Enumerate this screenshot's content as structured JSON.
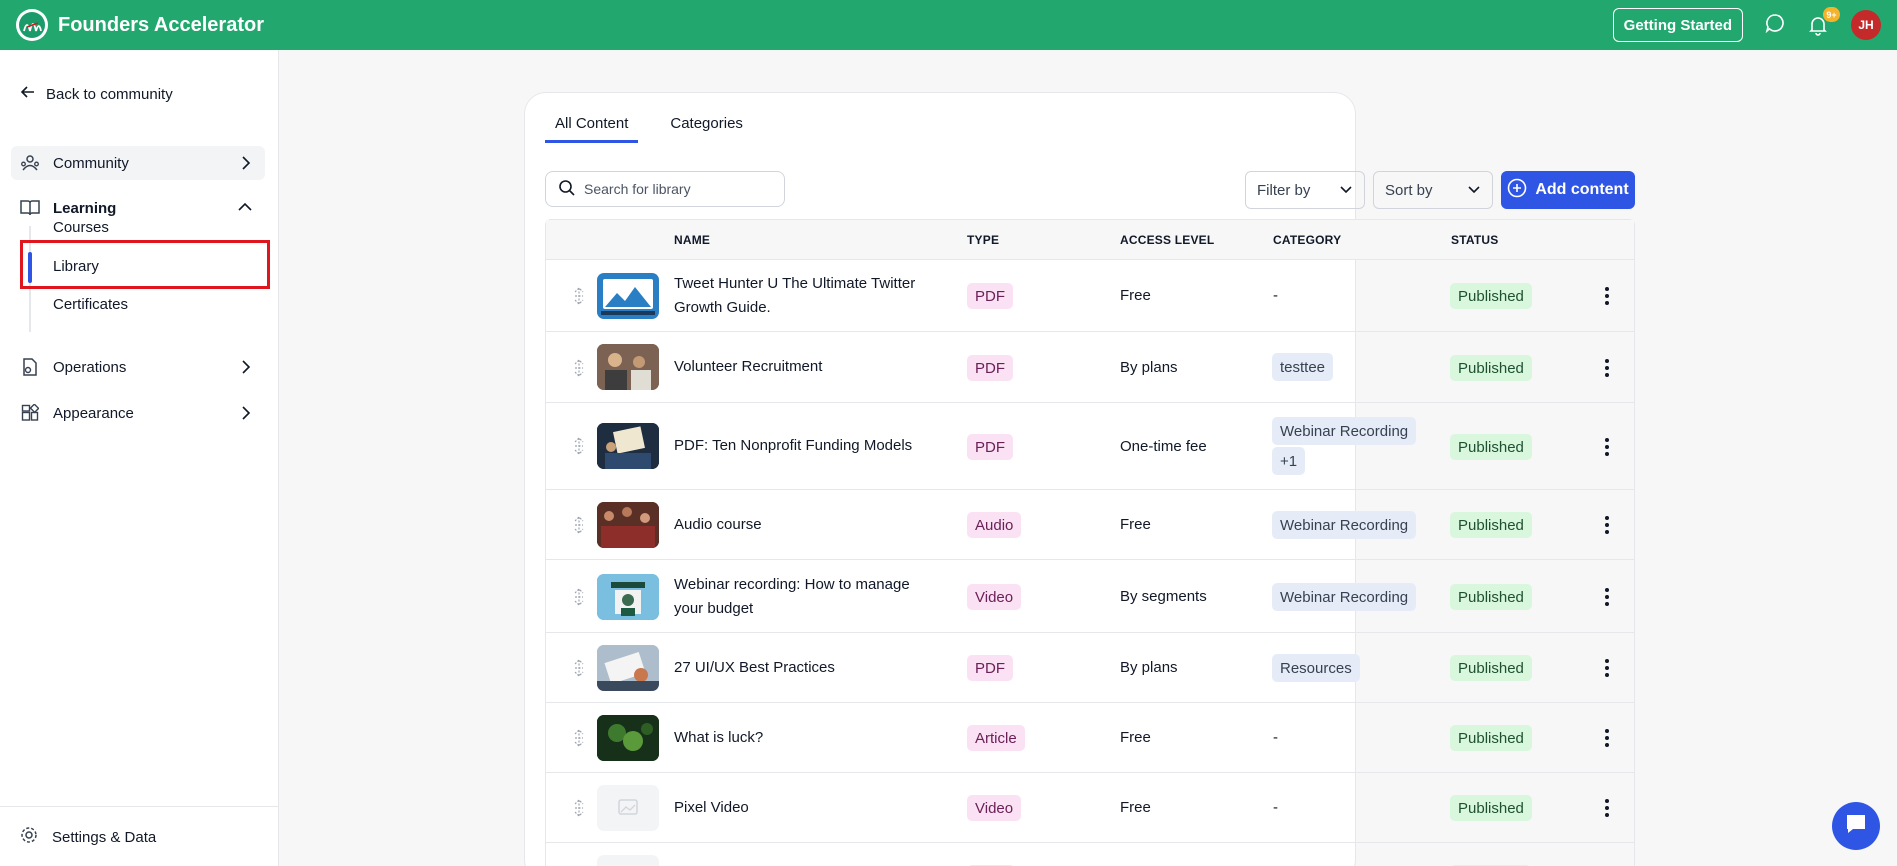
{
  "header": {
    "brand": "Founders Accelerator",
    "getting_started": "Getting Started",
    "notification_count": "9+",
    "user_initials": "JH",
    "icons": [
      "logo-icon",
      "chat-icon",
      "bell-icon"
    ]
  },
  "sidebar": {
    "back_label": "Back to community",
    "community": "Community",
    "learning": "Learning",
    "sub_items": {
      "courses": "Courses",
      "library": "Library",
      "certificates": "Certificates"
    },
    "operations": "Operations",
    "appearance": "Appearance",
    "settings": "Settings & Data"
  },
  "tabs": {
    "all_content": "All Content",
    "categories": "Categories"
  },
  "toolbar": {
    "search_placeholder": "Search for library",
    "filter_label": "Filter by",
    "sort_label": "Sort by",
    "add_label": "Add content"
  },
  "table": {
    "headers": {
      "name": "NAME",
      "type": "TYPE",
      "access": "ACCESS LEVEL",
      "category": "CATEGORY",
      "status": "STATUS"
    },
    "rows": [
      {
        "name_line1": "Tweet Hunter U The Ultimate Twitter",
        "name_line2": "Growth Guide.",
        "type": "PDF",
        "access": "Free",
        "category": "-",
        "status": "Published"
      },
      {
        "name_line1": "Volunteer Recruitment",
        "name_line2": "",
        "type": "PDF",
        "access": "By plans",
        "category": "testtee",
        "status": "Published"
      },
      {
        "name_line1": "PDF: Ten Nonprofit Funding Models",
        "name_line2": "",
        "type": "PDF",
        "access": "One-time fee",
        "category": "Webinar Recording",
        "category_extra": "+1",
        "status": "Published"
      },
      {
        "name_line1": "Audio course",
        "name_line2": "",
        "type": "Audio",
        "access": "Free",
        "category": "Webinar Recording",
        "status": "Published"
      },
      {
        "name_line1": "Webinar recording: How to manage",
        "name_line2": "your budget",
        "type": "Video",
        "access": "By segments",
        "category": "Webinar Recording",
        "status": "Published"
      },
      {
        "name_line1": "27 UI/UX Best Practices",
        "name_line2": "",
        "type": "PDF",
        "access": "By plans",
        "category": "Resources",
        "status": "Published"
      },
      {
        "name_line1": "What is luck?",
        "name_line2": "",
        "type": "Article",
        "access": "Free",
        "category": "-",
        "status": "Published"
      },
      {
        "name_line1": "Pixel Video",
        "name_line2": "",
        "type": "Video",
        "access": "Free",
        "category": "-",
        "status": "Published"
      }
    ]
  },
  "colors": {
    "brand_green": "#22a86f",
    "accent_blue": "#2f55e4",
    "highlight_red": "#e0161e"
  }
}
